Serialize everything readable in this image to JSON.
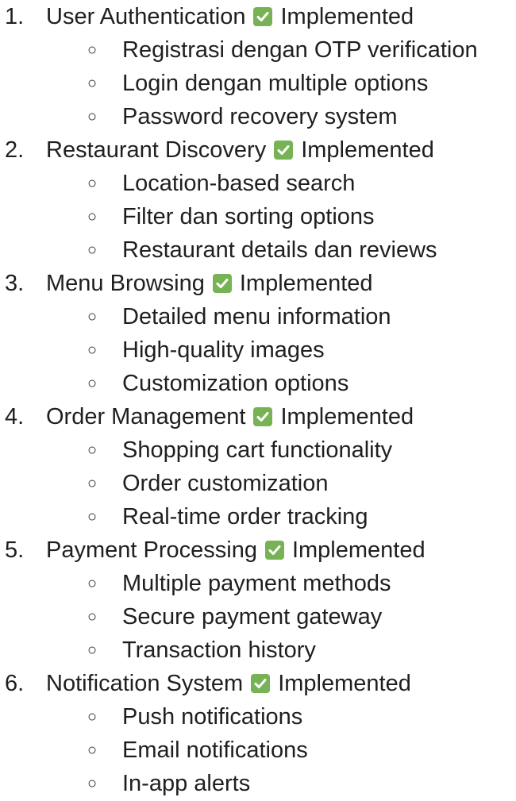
{
  "items": [
    {
      "number": "1.",
      "title": "User Authentication",
      "status": "Implemented",
      "subitems": [
        "Registrasi dengan OTP verification",
        "Login dengan multiple options",
        "Password recovery system"
      ]
    },
    {
      "number": "2.",
      "title": "Restaurant Discovery",
      "status": "Implemented",
      "subitems": [
        "Location-based search",
        "Filter dan sorting options",
        "Restaurant details dan reviews"
      ]
    },
    {
      "number": "3.",
      "title": "Menu Browsing",
      "status": "Implemented",
      "subitems": [
        "Detailed menu information",
        "High-quality images",
        "Customization options"
      ]
    },
    {
      "number": "4.",
      "title": "Order Management",
      "status": "Implemented",
      "subitems": [
        "Shopping cart functionality",
        "Order customization",
        "Real-time order tracking"
      ]
    },
    {
      "number": "5.",
      "title": "Payment Processing",
      "status": "Implemented",
      "subitems": [
        "Multiple payment methods",
        "Secure payment gateway",
        "Transaction history"
      ]
    },
    {
      "number": "6.",
      "title": "Notification System",
      "status": "Implemented",
      "subitems": [
        "Push notifications",
        "Email notifications",
        "In-app alerts"
      ]
    }
  ],
  "bullet_glyph": "○",
  "icons": {
    "status": "check-mark-button-icon"
  },
  "colors": {
    "text": "#1f1f1f",
    "check_bg": "#77b255",
    "check_mark": "#ffffff"
  }
}
